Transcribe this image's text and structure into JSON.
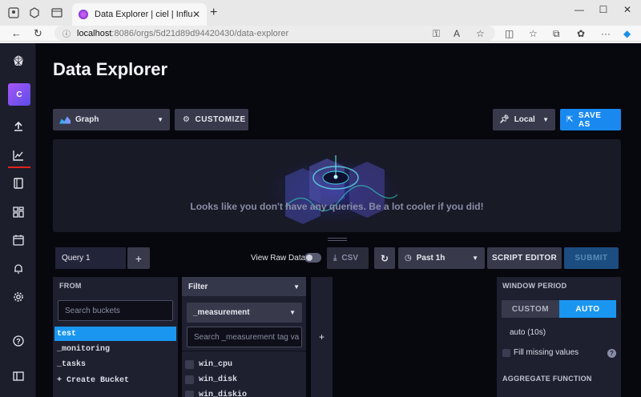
{
  "browser": {
    "tab_title": "Data Explorer | ciel | InfluxDB",
    "url_host": "localhost",
    "url_path": ":8086/orgs/5d21d89d94420430/data-explorer"
  },
  "sidenav": {
    "org_initial": "C"
  },
  "page": {
    "title": "Data Explorer"
  },
  "toolbar": {
    "vis_type": "Graph",
    "customize": "CUSTOMIZE",
    "timezone": "Local",
    "save_as": "SAVE AS"
  },
  "graph": {
    "empty_message": "Looks like you don't have any queries. Be a lot cooler if you did!"
  },
  "query_bar": {
    "query_tab": "Query 1",
    "add_query": "+",
    "raw_data_label": "View Raw Data",
    "raw_data_on": false,
    "csv": "CSV",
    "time_range": "Past 1h",
    "script_editor": "SCRIPT EDITOR",
    "submit": "SUBMIT"
  },
  "from": {
    "header": "FROM",
    "search_placeholder": "Search buckets",
    "buckets": [
      "test",
      "_monitoring",
      "_tasks",
      "+ Create Bucket"
    ],
    "selected": "test"
  },
  "filter": {
    "title": "Filter",
    "key": "_measurement",
    "search_placeholder": "Search _measurement tag va",
    "values": [
      "win_cpu",
      "win_disk",
      "win_diskio"
    ]
  },
  "add_filter": "+",
  "window": {
    "header": "WINDOW PERIOD",
    "custom": "CUSTOM",
    "auto": "AUTO",
    "auto_value": "auto (10s)",
    "fill_missing": "Fill missing values",
    "aggregate_header": "AGGREGATE FUNCTION"
  },
  "colors": {
    "accent": "#1a96f0",
    "save": "#1989f0",
    "active_nav": "#e0231b"
  }
}
